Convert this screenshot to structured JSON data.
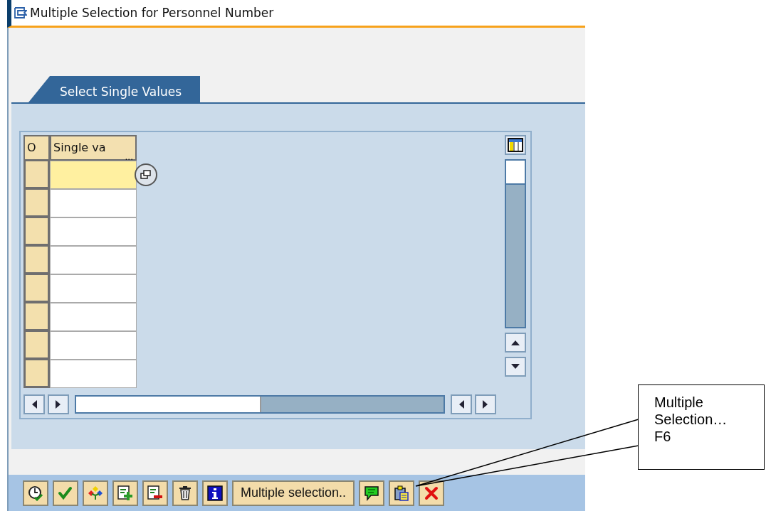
{
  "window": {
    "title": "Multiple Selection for Personnel Number"
  },
  "tabs": [
    {
      "label": "Select Single Values",
      "selected": true
    }
  ],
  "table": {
    "columns": [
      {
        "label": "O"
      },
      {
        "label": "Single va",
        "truncation": "..."
      }
    ],
    "rows": [
      {
        "selected": true
      },
      {
        "selected": false
      },
      {
        "selected": false
      },
      {
        "selected": false
      },
      {
        "selected": false
      },
      {
        "selected": false
      },
      {
        "selected": false
      },
      {
        "selected": false
      }
    ]
  },
  "toolbar": [
    {
      "kind": "history"
    },
    {
      "kind": "check"
    },
    {
      "kind": "diamonds"
    },
    {
      "kind": "add-rows"
    },
    {
      "kind": "delete-rows"
    },
    {
      "kind": "trash"
    },
    {
      "kind": "info"
    },
    {
      "kind": "text",
      "label": "Multiple selection.."
    },
    {
      "kind": "comment"
    },
    {
      "kind": "paste"
    },
    {
      "kind": "cancel"
    }
  ],
  "callout": {
    "lines": [
      "Multiple",
      "Selection…",
      "F6"
    ]
  }
}
